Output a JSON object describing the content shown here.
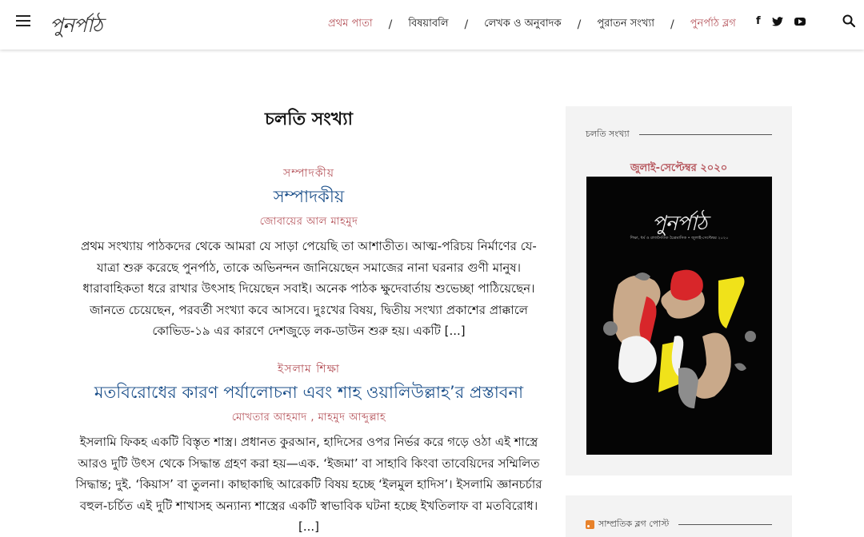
{
  "header": {
    "logo": "পুনর্পাঠ",
    "nav": [
      {
        "label": "প্রথম পাতা"
      },
      {
        "label": "বিষয়াবলি"
      },
      {
        "label": "লেখক ও অনুবাদক"
      },
      {
        "label": "পুরাতন সংখ্যা"
      },
      {
        "label": "পুনর্পাঠ ব্লগ"
      }
    ],
    "separator": "/",
    "social": {
      "facebook": "f"
    }
  },
  "main": {
    "section_title": "চলতি সংখ্যা",
    "articles": [
      {
        "category": "সম্পাদকীয়",
        "title": "সম্পাদকীয়",
        "author": "জোবায়ের আল মাহমুদ",
        "excerpt": "প্রথম সংখ্যায় পাঠকদের থেকে আমরা যে সাড়া পেয়েছি তা আশাতীত। আত্ম-পরিচয় নির্মাণের যে-যাত্রা শুরু করেছে পুনর্পাঠ, তাকে অভিনন্দন জানিয়েছেন সমাজের নানা ঘরনার গুণী মানুষ। ধারাবাহিকতা ধরে রাখার উৎসাহ দিয়েছেন সবাই। অনেক পাঠক ক্ষুদেবার্তায় শুভেচ্ছা পাঠিয়েছেন। জানতে চেয়েছেন, পরবর্তী সংখ্যা কবে আসবে। দুঃখের বিষয়, দ্বিতীয় সংখ্যা প্রকাশের প্রাক্কালে কোভিড-১৯ এর কারণে দেশজুড়ে লক-ডাউন শুরু হয়। একটি [...]"
      },
      {
        "category": "ইসলাম শিক্ষা",
        "title": "মতবিরোধের কারণ পর্যালোচনা এবং শাহ ওয়ালিউল্লাহ’র প্রস্তাবনা",
        "author": "মোখতার আহমাদ , মাহমুদ আব্দুল্লাহ",
        "excerpt": "ইসলামি ফিকহ একটি বিস্তৃত শাস্ত্র। প্রধানত কুরআন, হাদিসের ওপর নির্ভর করে গড়ে ওঠা এই শাস্ত্রে আরও দুটি উৎস থেকে সিদ্ধান্ত গ্রহণ করা হয়—এক. ‘ইজমা’ বা সাহাবি কিংবা তাবেয়িদের সম্মিলিত সিদ্ধান্ত; দুই. ‘কিয়াস’ বা তুলনা। কাছাকাছি আরেকটি বিষয় হচ্ছে ‘ইলমুল হাদিস’। ইসলামি জ্ঞানচর্চার বহুল-চর্চিত এই দুটি শাখাসহ অন্যান্য শাস্ত্রের একটি স্বাভাবিক ঘটনা হচ্ছে ইখতিলাফ বা মতবিরোধ। [...]"
      }
    ]
  },
  "sidebar": {
    "current_issue_heading": "চলতি সংখ্যা",
    "issue_label": "জুলাই-সেপ্টেম্বর ২০২০",
    "cover_logo": "পুনর্পাঠ",
    "cover_subtitle": "শিক্ষা, ধর্ম ও রাজনৈতিক চৈত্রমাসিক • জুলাই-সেপ্টেম্বর ২০২০",
    "blog_heading": "সাম্প্রতিক ব্লগ পোস্ট"
  },
  "colors": {
    "accent": "#b5535a",
    "title_blue": "#1b4f8a",
    "sidebar_bg": "#f3f3f3"
  }
}
